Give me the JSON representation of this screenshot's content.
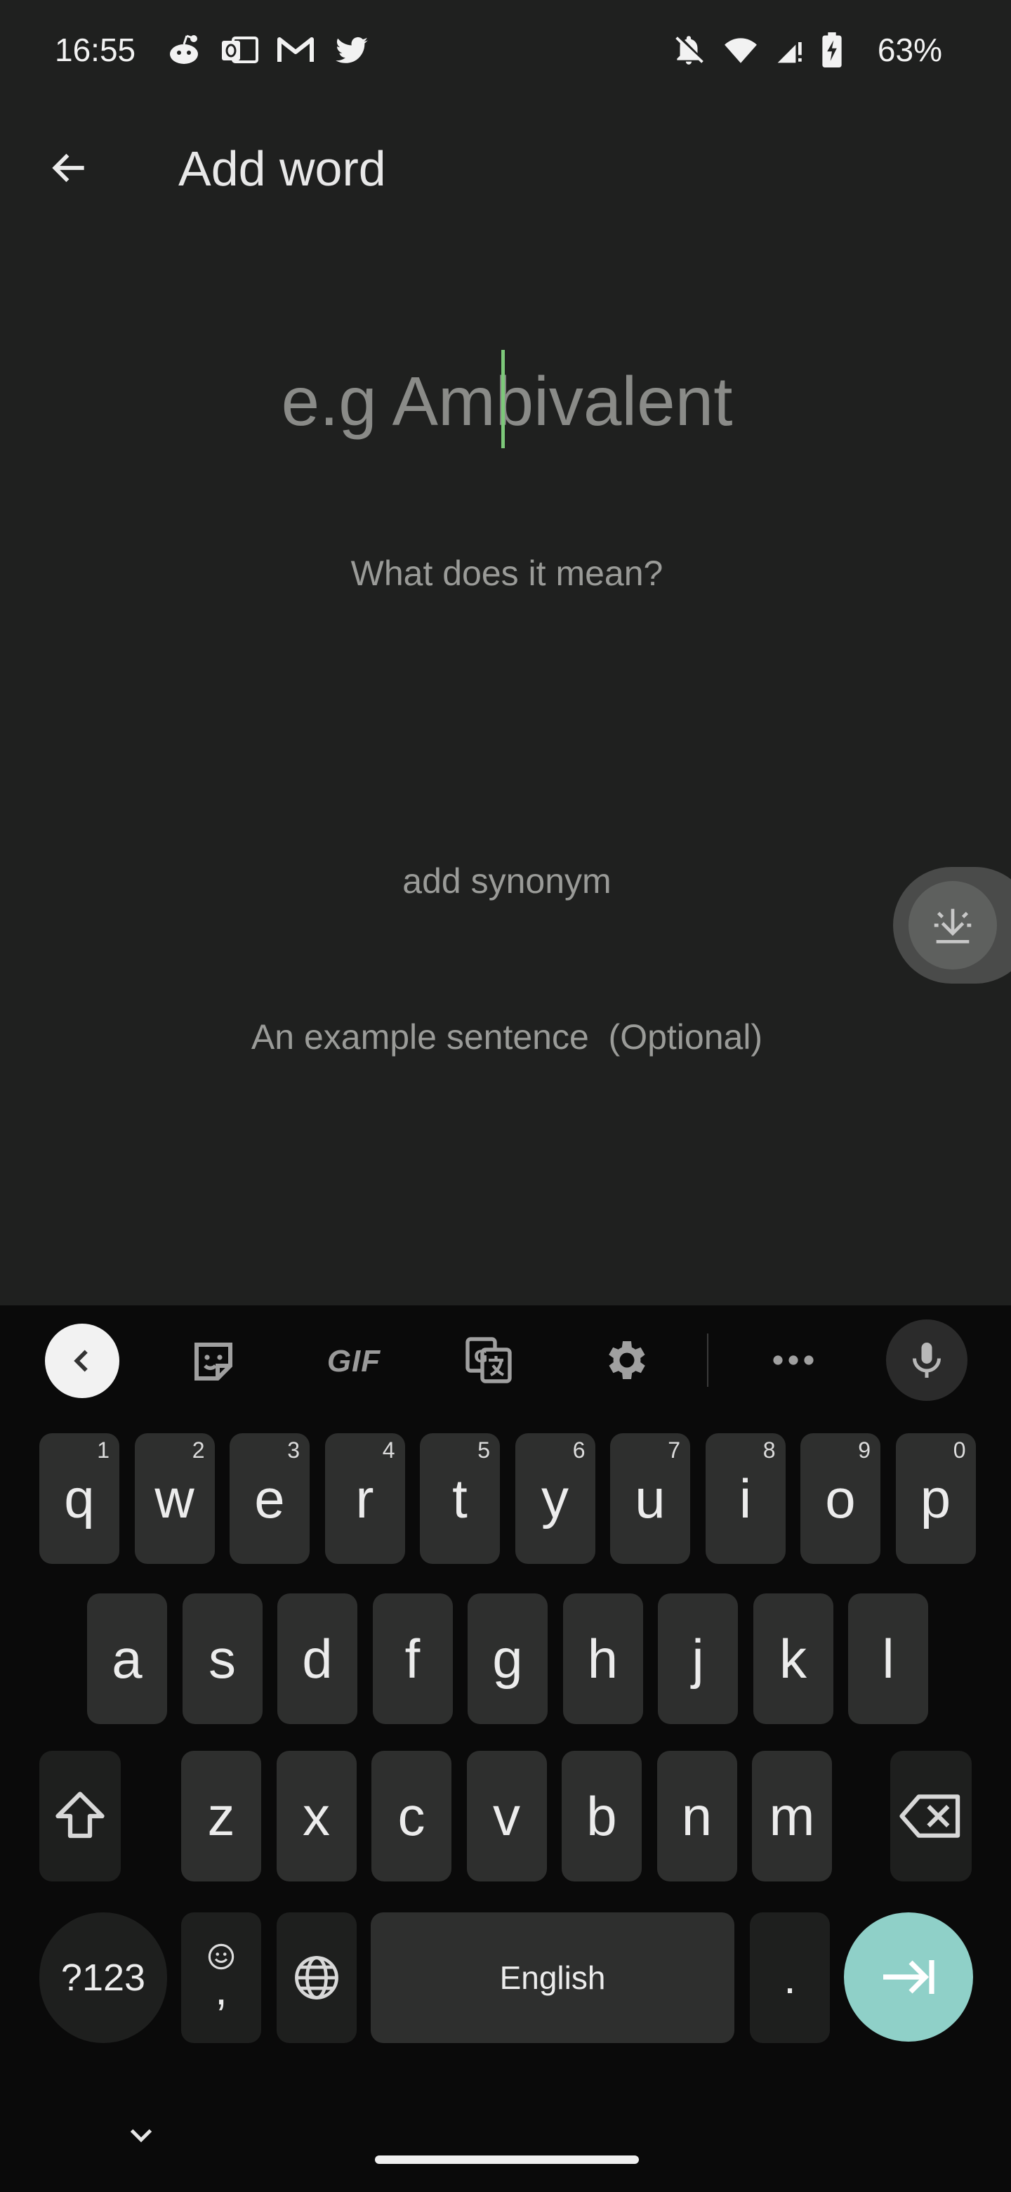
{
  "status_bar": {
    "time": "16:55",
    "left_icons": [
      "reddit-icon",
      "outlook-icon",
      "gmail-icon",
      "twitter-icon"
    ],
    "right_icons": [
      "dnd-bell-off-icon",
      "wifi-icon",
      "cell-signal-icon",
      "battery-charging-icon"
    ],
    "battery": "63%"
  },
  "app_bar": {
    "title": "Add word",
    "back_icon": "arrow-left-icon"
  },
  "form": {
    "word_placeholder": "e.g Ambivalent",
    "meaning_placeholder": "What does it mean?",
    "synonym_placeholder": "add synonym",
    "example_placeholder": "An example sentence  (Optional)",
    "caret_color": "#7dc97a"
  },
  "keyboard": {
    "toolbar": {
      "collapse_icon": "chevron-left-icon",
      "sticker_icon": "sticker-icon",
      "gif_label": "GIF",
      "translate_icon": "translate-icon",
      "settings_icon": "gear-icon",
      "more_icon": "more-horiz-icon",
      "mic_icon": "microphone-icon"
    },
    "row1": [
      {
        "key": "q",
        "hint": "1"
      },
      {
        "key": "w",
        "hint": "2"
      },
      {
        "key": "e",
        "hint": "3"
      },
      {
        "key": "r",
        "hint": "4"
      },
      {
        "key": "t",
        "hint": "5"
      },
      {
        "key": "y",
        "hint": "6"
      },
      {
        "key": "u",
        "hint": "7"
      },
      {
        "key": "i",
        "hint": "8"
      },
      {
        "key": "o",
        "hint": "9"
      },
      {
        "key": "p",
        "hint": "0"
      }
    ],
    "row2": [
      "a",
      "s",
      "d",
      "f",
      "g",
      "h",
      "j",
      "k",
      "l"
    ],
    "row3": [
      "z",
      "x",
      "c",
      "v",
      "b",
      "n",
      "m"
    ],
    "shift_icon": "shift-icon",
    "backspace_icon": "backspace-icon",
    "symbols_label": "?123",
    "comma_label": ",",
    "emoji_icon": "emoji-icon",
    "globe_icon": "globe-icon",
    "space_label": "English",
    "period_label": ".",
    "enter_icon": "tab-arrow-right-icon",
    "enter_color": "#8fd0c8"
  },
  "nav": {
    "hide_keyboard_icon": "chevron-down-icon"
  }
}
